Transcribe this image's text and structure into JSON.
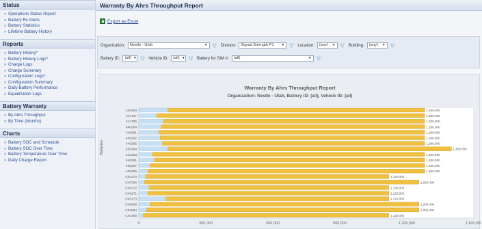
{
  "sidebar": {
    "sections": [
      {
        "title": "Status",
        "items": [
          "Operations Status Report",
          "Battery Rx Alerts",
          "Battery Statistics",
          "Lifetime Battery History"
        ]
      },
      {
        "title": "Reports",
        "items": [
          "Battery History*",
          "Battery History Logs*",
          "Charge Logs",
          "Charge Summary",
          "Configuration Logs*",
          "Configuration Summary",
          "Daily Battery Performance",
          "Equalization Logs"
        ]
      },
      {
        "title": "Battery Warranty",
        "items": [
          "By Ahrs Throughput",
          "By Time (Months)"
        ]
      },
      {
        "title": "Charts",
        "items": [
          "Battery SOC and Schedule",
          "Battery SOC Over Time",
          "Battery Temperature Over Time",
          "Daily Charge Report"
        ]
      }
    ]
  },
  "main": {
    "title": "Warranty By Ahrs Throughput Report",
    "export_label": "Export as Excel",
    "filters": {
      "organization_label": "Organization:",
      "organization_value": "Nestle - Utah",
      "division_label": "Division:",
      "division_value": "Signal Strength P1",
      "location_label": "Location:",
      "location_value": "(any)",
      "building_label": "Building:",
      "building_value": "(any)",
      "battery_label": "Battery ID:",
      "battery_value": "(all)",
      "vehicle_label": "Vehicle ID:",
      "vehicle_value": "(all)",
      "sim_label": "Battery for SIM #:",
      "sim_value": "(all)"
    }
  },
  "chart_data": {
    "type": "bar",
    "stacked": true,
    "orientation": "horizontal",
    "title": "Warranty By Ahrs Throughput Report",
    "subtitle": "Organization: Nestle - Utah, Battery ID: (all), Vehicle ID: (all)",
    "ylabel": "Batteries",
    "xlim": [
      0,
      1500000
    ],
    "xticks": [
      "0",
      "300,000",
      "600,000",
      "900,000",
      "1,200,000",
      "1,500,000"
    ],
    "colors": {
      "used": "#c7dff2",
      "used_stroke": "#9fc3e3",
      "remaining": "#f0c040",
      "remaining_stroke": "#c99818"
    },
    "categories": [
      "440283",
      "441787",
      "441785",
      "440284",
      "440281",
      "440282",
      "440285",
      "440294",
      "440293",
      "440291",
      "400287",
      "400405",
      "C40170",
      "C40780",
      "C40172",
      "C40171",
      "C40173",
      "C40068",
      "C51094",
      "C40165"
    ],
    "used": [
      130000,
      80000,
      110000,
      100000,
      90000,
      95000,
      105000,
      130000,
      60000,
      70000,
      50000,
      40000,
      30000,
      25000,
      45000,
      40000,
      120000,
      50000,
      35000,
      20000
    ],
    "totals": [
      1280000,
      1280000,
      1280000,
      1280000,
      1280000,
      1280000,
      1280000,
      1400000,
      1280000,
      1280000,
      1280000,
      1280000,
      1120000,
      1254400,
      1120000,
      1120000,
      1120000,
      1254400,
      1254400,
      1120000
    ]
  }
}
